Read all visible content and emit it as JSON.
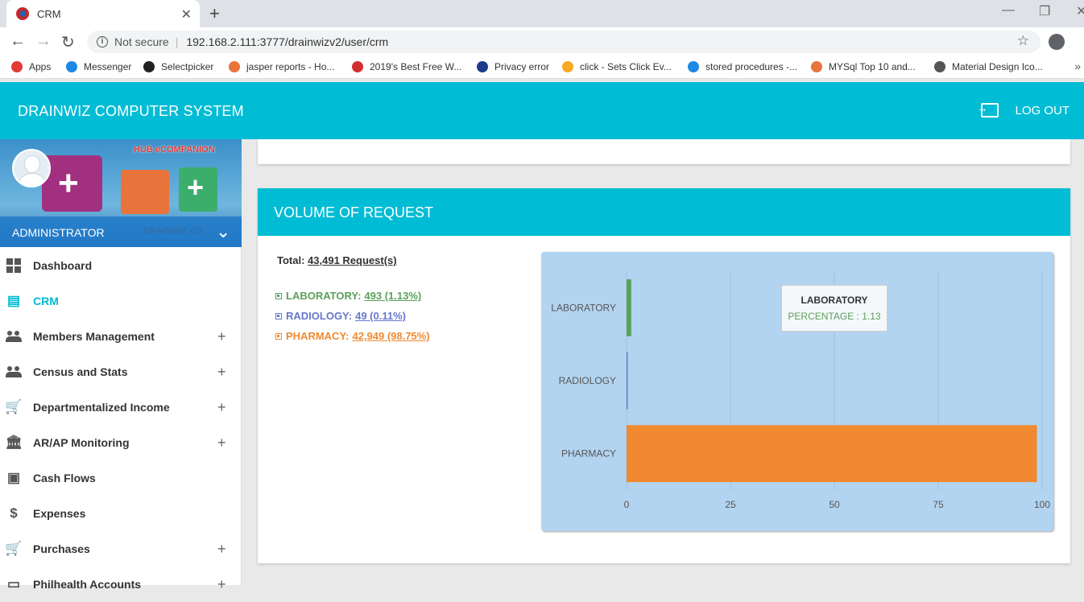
{
  "browser": {
    "tab_title": "CRM",
    "url_security": "Not secure",
    "url": "192.168.2.111:3777/drainwizv2/user/crm",
    "bookmarks": [
      {
        "label": "Apps",
        "color": "#e53935"
      },
      {
        "label": "Messenger",
        "color": "#1e88e5"
      },
      {
        "label": "Selectpicker",
        "color": "#222222"
      },
      {
        "label": "jasper reports - Ho...",
        "color": "#e8743b"
      },
      {
        "label": "2019's Best Free W...",
        "color": "#d32f2f"
      },
      {
        "label": "Privacy error",
        "color": "#1e3a8a"
      },
      {
        "label": "click - Sets Click Ev...",
        "color": "#f9a825"
      },
      {
        "label": "stored procedures -...",
        "color": "#1e88e5"
      },
      {
        "label": "MYSql Top 10 and...",
        "color": "#e8743b"
      },
      {
        "label": "Material Design Ico...",
        "color": "#555555"
      }
    ]
  },
  "header": {
    "title": "DRAINWIZ COMPUTER SYSTEM",
    "logout_label": "LOG OUT"
  },
  "sidebar": {
    "brand": "HUB eCOMPANION",
    "user_name": "ADMINISTRATOR",
    "user_sub": "DRAINWIZ CS",
    "items": [
      {
        "label": "Dashboard",
        "icon": "dashboard-icon",
        "expandable": false,
        "active": false
      },
      {
        "label": "CRM",
        "icon": "document-icon",
        "expandable": false,
        "active": true
      },
      {
        "label": "Members Management",
        "icon": "people-icon",
        "expandable": true,
        "active": false
      },
      {
        "label": "Census and Stats",
        "icon": "people-icon",
        "expandable": true,
        "active": false
      },
      {
        "label": "Departmentalized Income",
        "icon": "cart-icon",
        "expandable": true,
        "active": false
      },
      {
        "label": "AR/AP Monitoring",
        "icon": "bank-icon",
        "expandable": true,
        "active": false
      },
      {
        "label": "Cash Flows",
        "icon": "wallet-icon",
        "expandable": false,
        "active": false
      },
      {
        "label": "Expenses",
        "icon": "dollar-icon",
        "expandable": false,
        "active": false
      },
      {
        "label": "Purchases",
        "icon": "cart-icon",
        "expandable": true,
        "active": false
      },
      {
        "label": "Philhealth Accounts",
        "icon": "folder-icon",
        "expandable": true,
        "active": false
      }
    ],
    "plus_symbol": "+"
  },
  "main": {
    "card_title": "VOLUME OF REQUEST",
    "total_label": "Total:",
    "total_value": "43,491 Request(s)",
    "legend": [
      {
        "name": "LABORATORY:",
        "value": "493 (1.13%)",
        "color": "#5aa05a"
      },
      {
        "name": "RADIOLOGY:",
        "value": "49 (0.11%)",
        "color": "#6677cc"
      },
      {
        "name": "PHARMACY:",
        "value": "42,949 (98.75%)",
        "color": "#f0892f"
      }
    ],
    "tooltip": {
      "title": "LABORATORY",
      "text": "PERCENTAGE : 1.13"
    }
  },
  "chart_data": {
    "type": "bar",
    "orientation": "horizontal",
    "categories": [
      "LABORATORY",
      "RADIOLOGY",
      "PHARMACY"
    ],
    "values": [
      1.13,
      0.11,
      98.75
    ],
    "colors": [
      "#5aa05a",
      "#6677cc",
      "#f0892f"
    ],
    "xlim": [
      0,
      100
    ],
    "xticks": [
      0,
      25,
      50,
      75,
      100
    ],
    "grid": true
  }
}
